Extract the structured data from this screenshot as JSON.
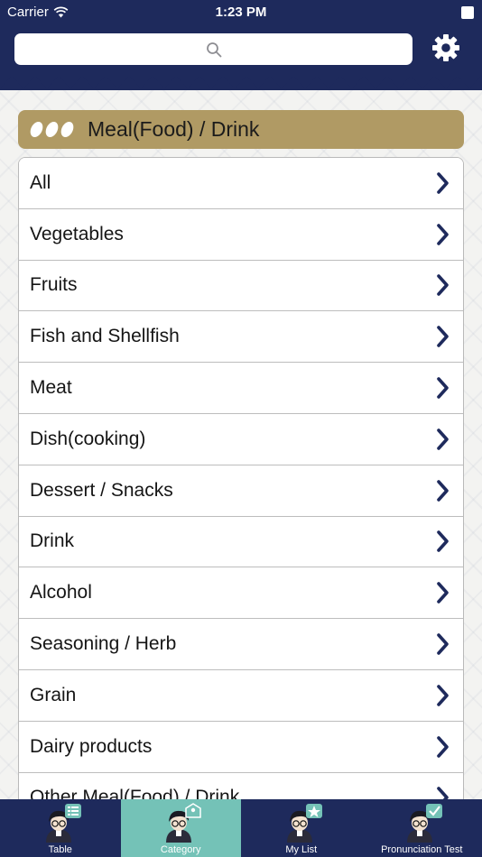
{
  "status_bar": {
    "carrier": "Carrier",
    "time": "1:23 PM",
    "wifi_icon": "wifi-icon",
    "battery_icon": "battery-icon"
  },
  "search": {
    "placeholder": "",
    "value": "",
    "icon": "search-icon"
  },
  "header": {
    "settings_icon": "gear-icon",
    "color": "#1e2a5c"
  },
  "category": {
    "title": "Meal(Food) / Drink",
    "color": "#b09a64"
  },
  "list": {
    "items": [
      {
        "label": "All"
      },
      {
        "label": "Vegetables"
      },
      {
        "label": "Fruits"
      },
      {
        "label": "Fish and Shellfish"
      },
      {
        "label": "Meat"
      },
      {
        "label": "Dish(cooking)"
      },
      {
        "label": "Dessert / Snacks"
      },
      {
        "label": "Drink"
      },
      {
        "label": "Alcohol"
      },
      {
        "label": "Seasoning / Herb"
      },
      {
        "label": "Grain"
      },
      {
        "label": "Dairy products"
      },
      {
        "label": "Other Meal(Food) / Drink"
      }
    ],
    "chevron_icon": "chevron-right-icon"
  },
  "tabbar": {
    "active_color": "#74c2b7",
    "tabs": [
      {
        "label": "Table",
        "icon": "avatar-list-icon",
        "active": false
      },
      {
        "label": "Category",
        "icon": "avatar-tag-icon",
        "active": true
      },
      {
        "label": "My List",
        "icon": "avatar-star-icon",
        "active": false
      },
      {
        "label": "Pronunciation Test",
        "icon": "avatar-check-icon",
        "active": false
      }
    ]
  }
}
